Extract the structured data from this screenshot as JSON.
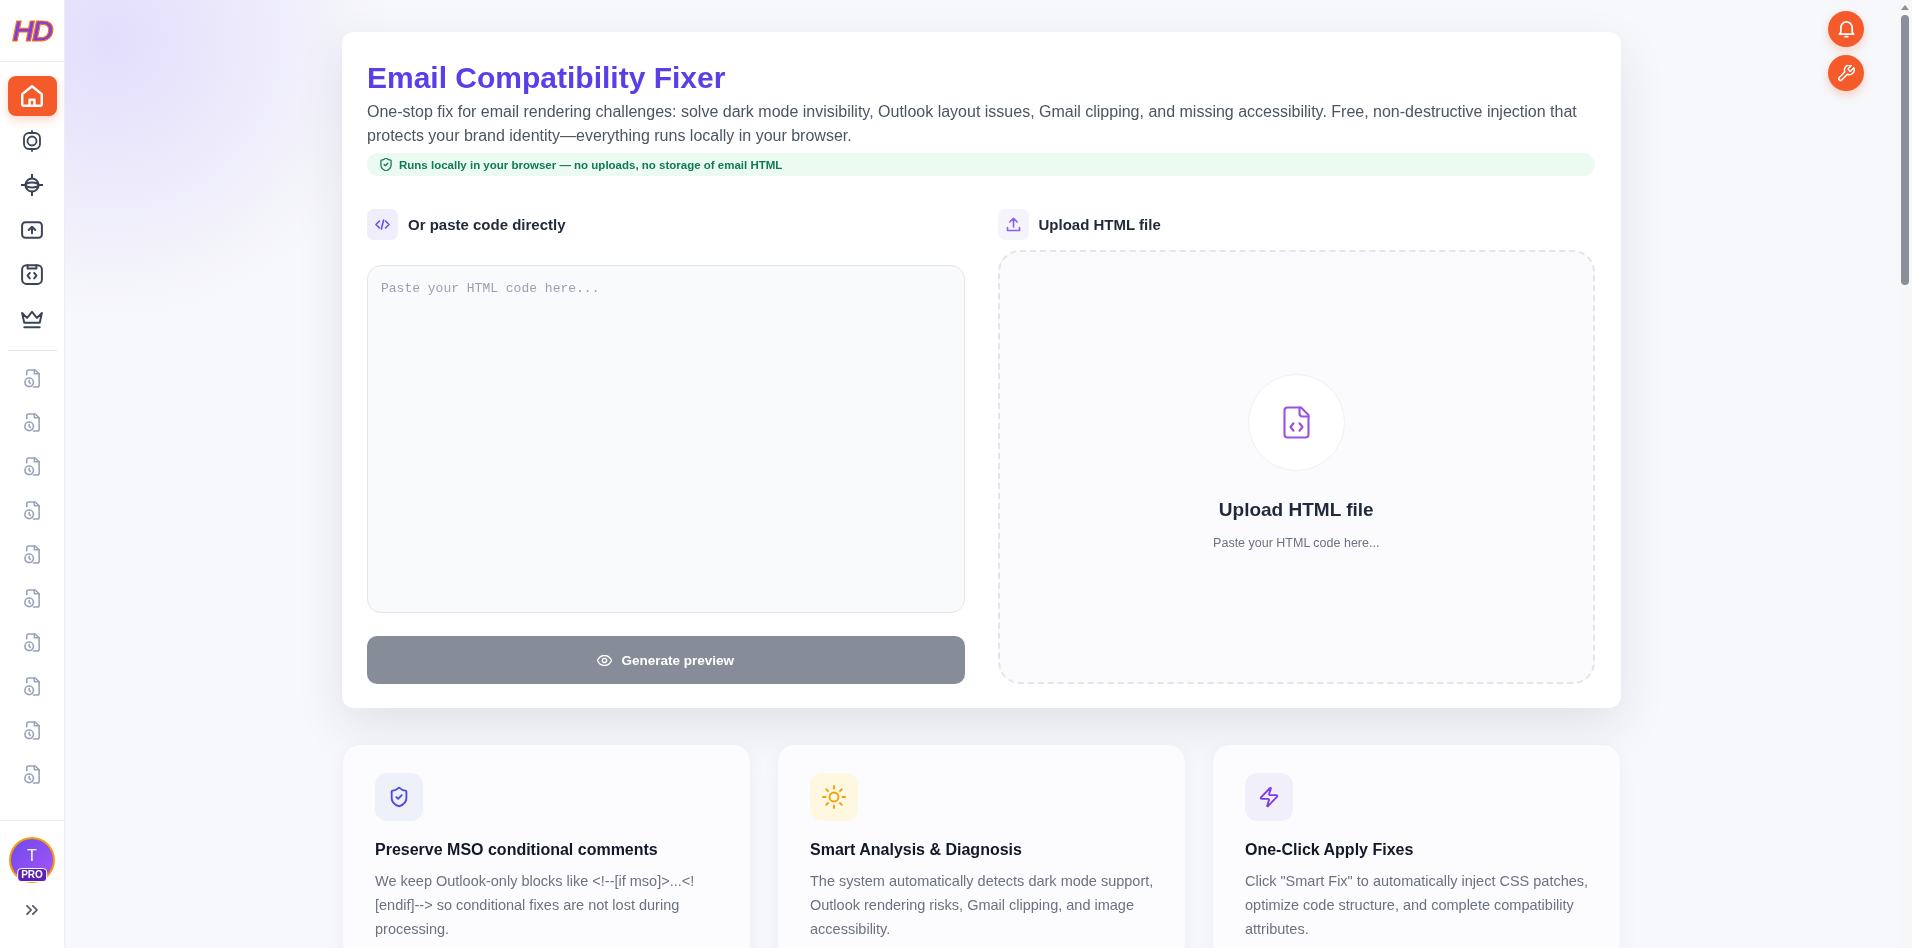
{
  "sidebar": {
    "logo": "HD",
    "nav_items": [
      {
        "selected": true
      },
      {
        "selected": false
      },
      {
        "selected": false
      },
      {
        "selected": false
      },
      {
        "selected": false
      },
      {
        "selected": false
      }
    ],
    "recent_items": [
      {
        "selected": false
      },
      {
        "selected": false
      },
      {
        "selected": false
      },
      {
        "selected": false
      },
      {
        "selected": false
      },
      {
        "selected": false
      },
      {
        "selected": false
      },
      {
        "selected": false
      },
      {
        "selected": false
      },
      {
        "selected": false
      }
    ],
    "avatar": {
      "initial": "T",
      "badge": "PRO"
    }
  },
  "tool": {
    "title": "Email Compatibility Fixer",
    "description": "One-stop fix for email rendering challenges: solve dark mode invisibility, Outlook layout issues, Gmail clipping, and missing accessibility. Free, non-destructive injection that protects your brand identity—everything runs locally in your browser.",
    "privacy_note": "Runs locally in your browser — no uploads, no storage of email HTML",
    "paste_panel": {
      "label": "Or paste code directly",
      "placeholder": "Paste your HTML code here...",
      "button": {
        "label": "Generate preview",
        "disabled": true
      }
    },
    "upload_panel": {
      "label": "Upload HTML file",
      "title": "Upload HTML file",
      "hint": "Paste your HTML code here..."
    }
  },
  "features": [
    {
      "title": "Preserve MSO conditional comments",
      "description": "We keep Outlook-only blocks like <!--[if mso]>...<![endif]--> so conditional fixes are not lost during processing."
    },
    {
      "title": "Smart Analysis & Diagnosis",
      "description": "The system automatically detects dark mode support, Outlook rendering risks, Gmail clipping, and image accessibility."
    },
    {
      "title": "One-Click Apply Fixes",
      "description": "Click \"Smart Fix\" to automatically inject CSS patches, optimize code structure, and complete compatibility attributes."
    }
  ]
}
